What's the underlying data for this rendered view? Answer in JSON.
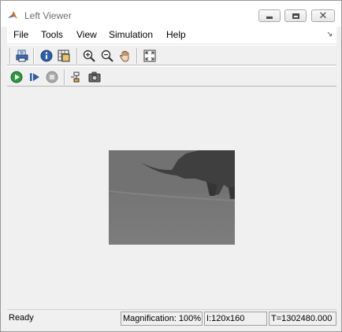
{
  "window": {
    "title": "Left Viewer"
  },
  "menu": {
    "items": [
      "File",
      "Tools",
      "View",
      "Simulation",
      "Help"
    ]
  },
  "toolbar_top": {
    "buttons": [
      {
        "name": "print-icon"
      },
      {
        "name": "info-icon"
      },
      {
        "name": "pixel-region-icon"
      },
      {
        "name": "zoom-in-icon"
      },
      {
        "name": "zoom-out-icon"
      },
      {
        "name": "pan-hand-icon"
      },
      {
        "name": "fit-to-window-icon"
      }
    ]
  },
  "toolbar_sim": {
    "buttons": [
      {
        "name": "run-icon"
      },
      {
        "name": "step-forward-icon"
      },
      {
        "name": "stop-icon"
      },
      {
        "name": "highlight-block-icon"
      },
      {
        "name": "snapshot-camera-icon"
      }
    ]
  },
  "status": {
    "state": "Ready",
    "magnification": "Magnification: 100%",
    "size": "I:120x160",
    "time": "T=1302480.000"
  },
  "colors": {
    "run_green": "#2e9b3a",
    "window_bg": "#f0f0f0",
    "frame_gray": "#777777"
  }
}
